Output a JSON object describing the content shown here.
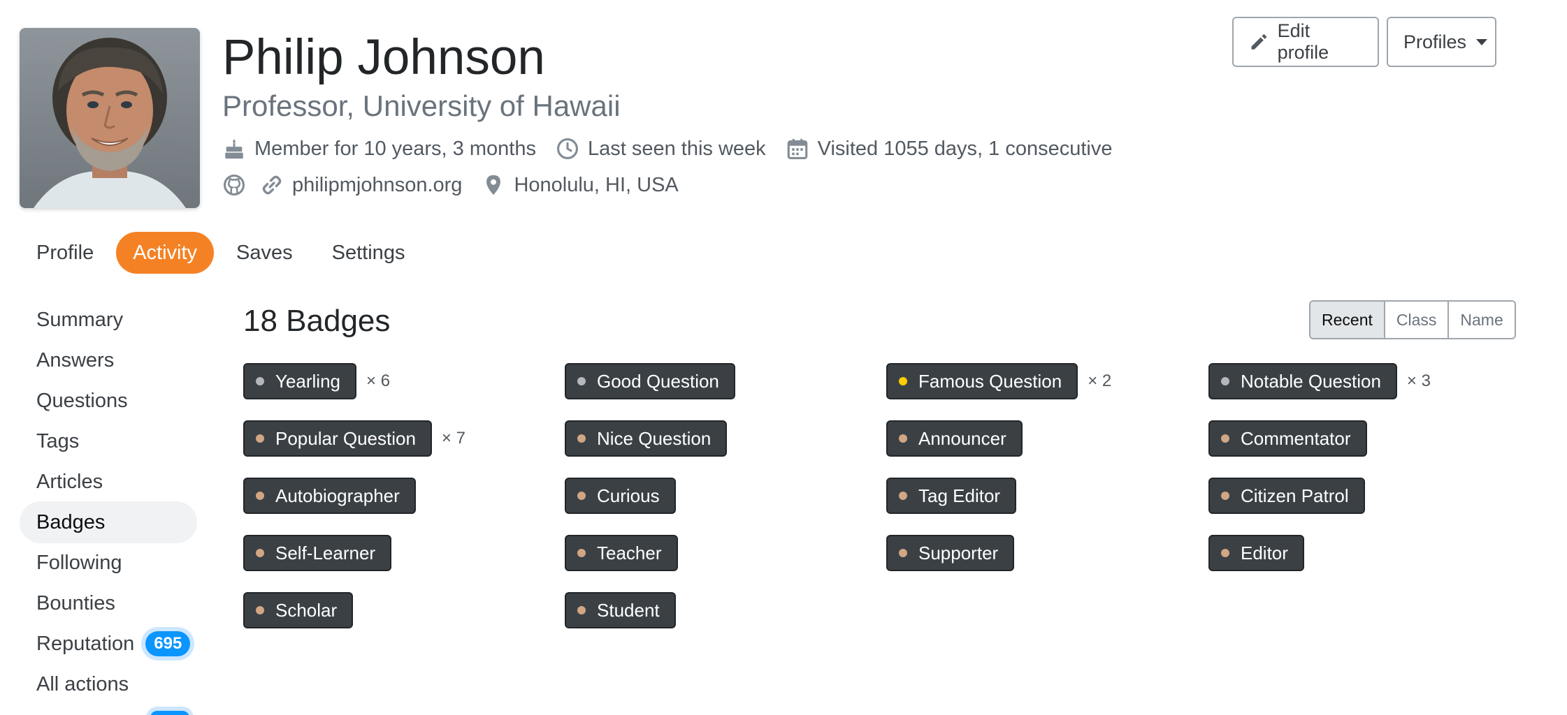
{
  "user": {
    "name": "Philip Johnson",
    "title": "Professor, University of Hawaii",
    "member_for": "Member for 10 years, 3 months",
    "last_seen": "Last seen this week",
    "visited": "Visited 1055 days, 1 consecutive",
    "website": "philipmjohnson.org",
    "location": "Honolulu, HI, USA"
  },
  "header_buttons": {
    "edit_profile": "Edit profile",
    "profiles": "Profiles"
  },
  "tabs": [
    {
      "label": "Profile",
      "active": false
    },
    {
      "label": "Activity",
      "active": true
    },
    {
      "label": "Saves",
      "active": false
    },
    {
      "label": "Settings",
      "active": false
    }
  ],
  "sidebar": {
    "items": [
      {
        "label": "Summary"
      },
      {
        "label": "Answers"
      },
      {
        "label": "Questions"
      },
      {
        "label": "Tags"
      },
      {
        "label": "Articles"
      },
      {
        "label": "Badges",
        "active": true
      },
      {
        "label": "Following"
      },
      {
        "label": "Bounties"
      },
      {
        "label": "Reputation",
        "badge": "695"
      },
      {
        "label": "All actions"
      }
    ]
  },
  "badges_section": {
    "title": "18 Badges",
    "sort_options": [
      "Recent",
      "Class",
      "Name"
    ],
    "sort_selected": "Recent"
  },
  "badge_classes": {
    "silver": "#b4b8bc",
    "gold": "#ffcc01",
    "bronze": "#d1a684"
  },
  "colors": {
    "accent": "#f48225",
    "badge_bg": "#3b4045",
    "reputation_badge": "#0a95ff"
  },
  "badges": [
    {
      "name": "Yearling",
      "class": "silver",
      "count": "× 6"
    },
    {
      "name": "Good Question",
      "class": "silver",
      "count": ""
    },
    {
      "name": "Famous Question",
      "class": "gold",
      "count": "× 2"
    },
    {
      "name": "Notable Question",
      "class": "silver",
      "count": "× 3"
    },
    {
      "name": "Popular Question",
      "class": "bronze",
      "count": "× 7"
    },
    {
      "name": "Nice Question",
      "class": "bronze",
      "count": ""
    },
    {
      "name": "Announcer",
      "class": "bronze",
      "count": ""
    },
    {
      "name": "Commentator",
      "class": "bronze",
      "count": ""
    },
    {
      "name": "Autobiographer",
      "class": "bronze",
      "count": ""
    },
    {
      "name": "Curious",
      "class": "bronze",
      "count": ""
    },
    {
      "name": "Tag Editor",
      "class": "bronze",
      "count": ""
    },
    {
      "name": "Citizen Patrol",
      "class": "bronze",
      "count": ""
    },
    {
      "name": "Self-Learner",
      "class": "bronze",
      "count": ""
    },
    {
      "name": "Teacher",
      "class": "bronze",
      "count": ""
    },
    {
      "name": "Supporter",
      "class": "bronze",
      "count": ""
    },
    {
      "name": "Editor",
      "class": "bronze",
      "count": ""
    },
    {
      "name": "Scholar",
      "class": "bronze",
      "count": ""
    },
    {
      "name": "Student",
      "class": "bronze",
      "count": ""
    }
  ]
}
